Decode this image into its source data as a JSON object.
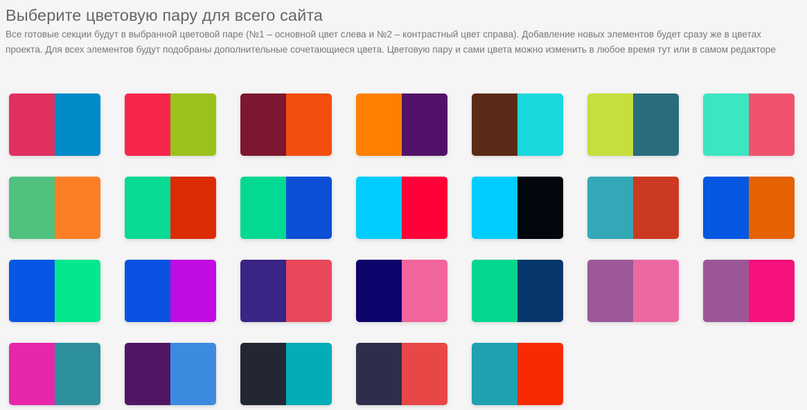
{
  "header": {
    "title": "Выберите цветовую пару для всего сайта",
    "description": "Все готовые секции будут в выбранной цветовой паре (№1 – основной цвет слева и №2 – контрастный цвет справа). Добавление новых элементов будет сразу же в цветах проекта. Для всех элементов будут подобраны дополнительные сочетающиеся цвета. Цветовую пару и сами цвета можно изменить в любое время тут или в самом редакторе"
  },
  "palettes": [
    {
      "primary": "#e03060",
      "contrast": "#008ac8"
    },
    {
      "primary": "#f8264b",
      "contrast": "#9ac21b"
    },
    {
      "primary": "#7d1730",
      "contrast": "#f24e0e"
    },
    {
      "primary": "#ff7f00",
      "contrast": "#521168"
    },
    {
      "primary": "#5a2b16",
      "contrast": "#1ad8dc"
    },
    {
      "primary": "#c6de3e",
      "contrast": "#296c7c"
    },
    {
      "primary": "#3be6c0",
      "contrast": "#f0526e"
    },
    {
      "primary": "#50c17f",
      "contrast": "#fc7f26"
    },
    {
      "primary": "#08d993",
      "contrast": "#dc2b07"
    },
    {
      "primary": "#04d993",
      "contrast": "#0c4ed5"
    },
    {
      "primary": "#00cdfd",
      "contrast": "#ff0038"
    },
    {
      "primary": "#00cdfd",
      "contrast": "#02060d"
    },
    {
      "primary": "#33a8b7",
      "contrast": "#cb3a20"
    },
    {
      "primary": "#0657e2",
      "contrast": "#e56102"
    },
    {
      "primary": "#0656e3",
      "contrast": "#02e78e"
    },
    {
      "primary": "#0b52e2",
      "contrast": "#c10ce3"
    },
    {
      "primary": "#3a2485",
      "contrast": "#e8495a"
    },
    {
      "primary": "#0c036b",
      "contrast": "#f2649c"
    },
    {
      "primary": "#04d78d",
      "contrast": "#07376b"
    },
    {
      "primary": "#9c5899",
      "contrast": "#ec68a2"
    },
    {
      "primary": "#9d5799",
      "contrast": "#f6117c"
    },
    {
      "primary": "#e826ac",
      "contrast": "#2e8f9e"
    },
    {
      "primary": "#501663",
      "contrast": "#3b8ce1"
    },
    {
      "primary": "#222733",
      "contrast": "#03adb5"
    },
    {
      "primary": "#2e2e4c",
      "contrast": "#e84747"
    },
    {
      "primary": "#20a1b1",
      "contrast": "#f82a01"
    }
  ]
}
